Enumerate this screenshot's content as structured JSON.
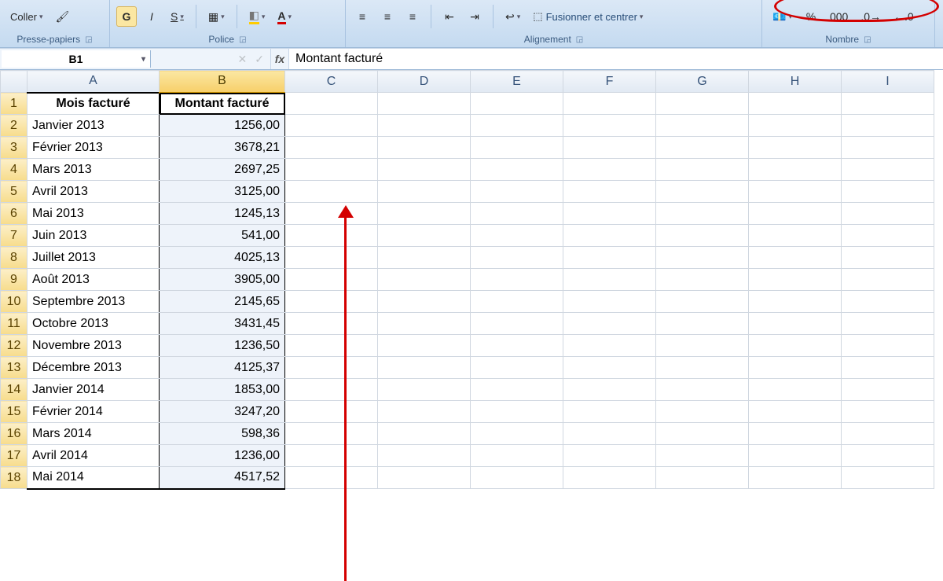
{
  "ribbon": {
    "clipboard": {
      "paste": "Coller",
      "group": "Presse-papiers"
    },
    "font": {
      "bold": "G",
      "italic": "I",
      "underline": "S",
      "group": "Police"
    },
    "alignment": {
      "merge": "Fusionner et centrer",
      "group": "Alignement"
    },
    "number": {
      "percent": "%",
      "thousands": "000",
      "group": "Nombre"
    }
  },
  "namebox": "B1",
  "fx_label": "fx",
  "formula_value": "Montant facturé",
  "columns": [
    "A",
    "B",
    "C",
    "D",
    "E",
    "F",
    "G",
    "H",
    "I"
  ],
  "selected_column": "B",
  "active_cell": "B1",
  "headers": {
    "A": "Mois facturé",
    "B": "Montant facturé"
  },
  "rows": [
    {
      "month": "Janvier 2013",
      "amount": "1256,00"
    },
    {
      "month": "Février 2013",
      "amount": "3678,21"
    },
    {
      "month": "Mars 2013",
      "amount": "2697,25"
    },
    {
      "month": "Avril 2013",
      "amount": "3125,00"
    },
    {
      "month": "Mai 2013",
      "amount": "1245,13"
    },
    {
      "month": "Juin 2013",
      "amount": "541,00"
    },
    {
      "month": "Juillet 2013",
      "amount": "4025,13"
    },
    {
      "month": "Août 2013",
      "amount": "3905,00"
    },
    {
      "month": "Septembre 2013",
      "amount": "2145,65"
    },
    {
      "month": "Octobre 2013",
      "amount": "3431,45"
    },
    {
      "month": "Novembre 2013",
      "amount": "1236,50"
    },
    {
      "month": "Décembre 2013",
      "amount": "4125,37"
    },
    {
      "month": "Janvier 2014",
      "amount": "1853,00"
    },
    {
      "month": "Février 2014",
      "amount": "3247,20"
    },
    {
      "month": "Mars 2014",
      "amount": "598,36"
    },
    {
      "month": "Avril 2014",
      "amount": "1236,00"
    },
    {
      "month": "Mai 2014",
      "amount": "4517,52"
    }
  ]
}
